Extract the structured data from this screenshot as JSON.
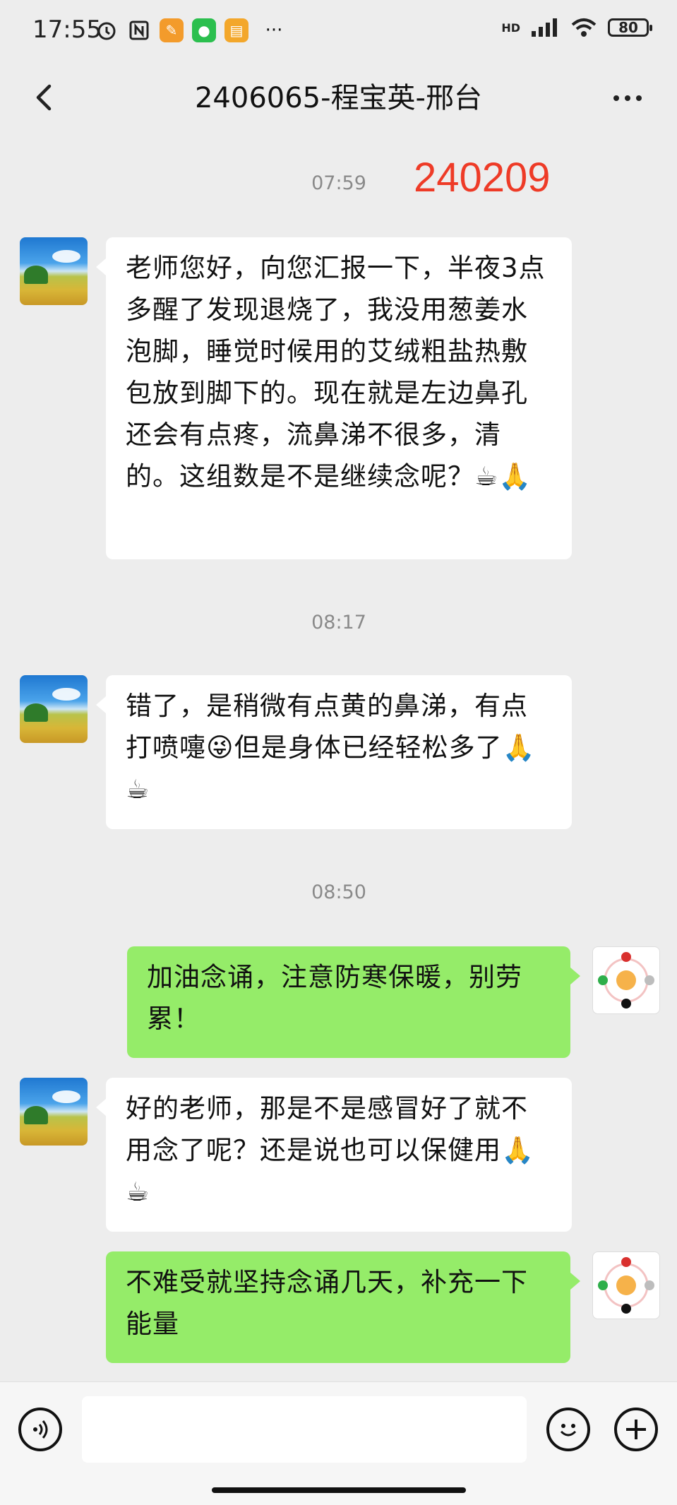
{
  "status_bar": {
    "time": "17:55",
    "icons": [
      "alarm-icon",
      "nfc-icon",
      "app-notification-icon",
      "wechat-icon",
      "notes-icon"
    ],
    "more": "···",
    "network": "HD",
    "battery": "80"
  },
  "header": {
    "title": "2406065-程宝英-邢台"
  },
  "annotation": "240209",
  "messages": [
    {
      "type": "time",
      "text": "07:59"
    },
    {
      "type": "in",
      "text": "老师您好，向您汇报一下，半夜3点多醒了发现退烧了，我没用葱姜水泡脚，睡觉时候用的艾绒粗盐热敷包放到脚下的。现在就是左边鼻孔还会有点疼，流鼻涕不很多，清的。这组数是不是继续念呢？☕🙏"
    },
    {
      "type": "time",
      "text": "08:17"
    },
    {
      "type": "in",
      "text": "错了，是稍微有点黄的鼻涕，有点打喷嚏😜但是身体已经轻松多了🙏☕"
    },
    {
      "type": "time",
      "text": "08:50"
    },
    {
      "type": "out",
      "text": "加油念诵，注意防寒保暖，别劳累！"
    },
    {
      "type": "in",
      "text": "好的老师，那是不是感冒好了就不用念了呢？还是说也可以保健用🙏☕"
    },
    {
      "type": "out",
      "text": "不难受就坚持念诵几天，补充一下能量"
    }
  ]
}
